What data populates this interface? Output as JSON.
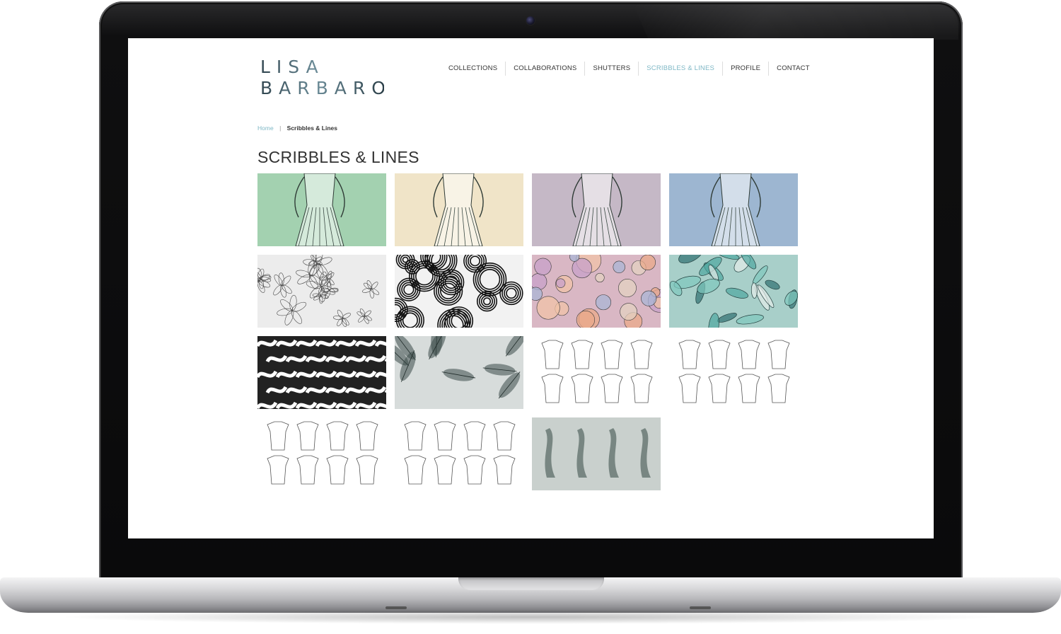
{
  "site": {
    "logo": {
      "line1": "LISA",
      "line2": "BARBARO"
    },
    "nav": [
      {
        "label": "COLLECTIONS",
        "active": false
      },
      {
        "label": "COLLABORATIONS",
        "active": false
      },
      {
        "label": "SHUTTERS",
        "active": false
      },
      {
        "label": "SCRIBBLES & LINES",
        "active": true
      },
      {
        "label": "PROFILE",
        "active": false
      },
      {
        "label": "CONTACT",
        "active": false
      }
    ],
    "breadcrumb": {
      "home": "Home",
      "separator": "|",
      "current": "Scribbles & Lines"
    },
    "page_title": "SCRIBBLES & LINES",
    "colors": {
      "accent": "#7fb8c6",
      "text": "#333333",
      "thumb_green": "#a3d1b0",
      "thumb_cream": "#f0e4c8",
      "thumb_mauve": "#c5b8c6",
      "thumb_blue": "#9db6d1"
    },
    "gallery": [
      {
        "name": "fashion-illustration-green-thumb",
        "kind": "figure",
        "bg": "#a3d1b0"
      },
      {
        "name": "fashion-illustration-cream-thumb",
        "kind": "figure",
        "bg": "#f0e4c8"
      },
      {
        "name": "fashion-illustration-mauve-thumb",
        "kind": "figure",
        "bg": "#c5b8c6"
      },
      {
        "name": "fashion-illustration-blue-thumb",
        "kind": "figure",
        "bg": "#9db6d1"
      },
      {
        "name": "floral-line-print-thumb",
        "kind": "flowers",
        "bg": "#ececec"
      },
      {
        "name": "paisley-doodle-print-thumb",
        "kind": "paisley",
        "bg": "#f2f2f2"
      },
      {
        "name": "pastel-floral-print-thumb",
        "kind": "pastel",
        "bg": "#d9b7c4"
      },
      {
        "name": "teal-floral-print-thumb",
        "kind": "teal",
        "bg": "#a8cfc9"
      },
      {
        "name": "monochrome-geometric-print-thumb",
        "kind": "mono",
        "bg": "#222222"
      },
      {
        "name": "feather-watercolor-print-thumb",
        "kind": "feathers",
        "bg": "#d7dcdb"
      },
      {
        "name": "technical-flats-tops-thumb",
        "kind": "flats",
        "bg": "#ffffff"
      },
      {
        "name": "technical-flats-shorts-trousers-thumb",
        "kind": "flats",
        "bg": "#ffffff"
      },
      {
        "name": "technical-flats-jackets-thumb",
        "kind": "flats",
        "bg": "#ffffff"
      },
      {
        "name": "technical-flats-swimwear-thumb",
        "kind": "flats",
        "bg": "#ffffff"
      },
      {
        "name": "figures-in-mist-thumb",
        "kind": "mist",
        "bg": "#c9d0cd"
      }
    ]
  }
}
